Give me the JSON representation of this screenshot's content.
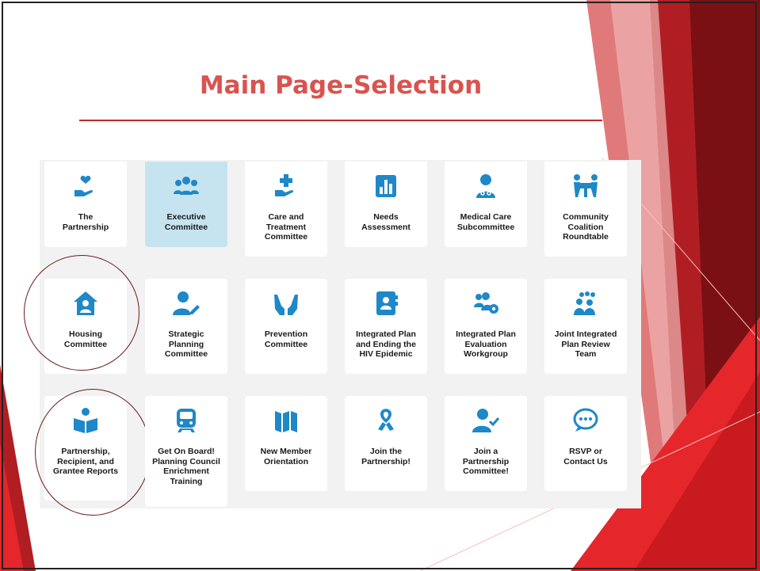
{
  "slide": {
    "title": "Main Page-Selection",
    "accent_color": "#c0282d",
    "title_color": "#d9534f"
  },
  "menu": {
    "icon_color": "#1e88c8",
    "items": [
      {
        "label": "The\nPartnership",
        "icon": "heart-hand-icon",
        "active": false,
        "circled": false
      },
      {
        "label": "Executive\nCommittee",
        "icon": "group-icon",
        "active": true,
        "circled": false
      },
      {
        "label": "Care and\nTreatment\nCommittee",
        "icon": "plus-hand-icon",
        "active": false,
        "circled": false
      },
      {
        "label": "Needs\nAssessment",
        "icon": "bar-chart-icon",
        "active": false,
        "circled": false
      },
      {
        "label": "Medical Care\nSubcommittee",
        "icon": "doctor-icon",
        "active": false,
        "circled": false
      },
      {
        "label": "Community\nCoalition\nRoundtable",
        "icon": "people-table-icon",
        "active": false,
        "circled": false
      },
      {
        "label": "Housing\nCommittee",
        "icon": "house-user-icon",
        "active": false,
        "circled": true
      },
      {
        "label": "Strategic\nPlanning\nCommittee",
        "icon": "user-pen-icon",
        "active": false,
        "circled": false
      },
      {
        "label": "Prevention\nCommittee",
        "icon": "hands-icon",
        "active": false,
        "circled": false
      },
      {
        "label": "Integrated Plan\nand Ending the\nHIV Epidemic",
        "icon": "address-book-icon",
        "active": false,
        "circled": false
      },
      {
        "label": "Integrated Plan\nEvaluation\nWorkgroup",
        "icon": "users-gear-icon",
        "active": false,
        "circled": false
      },
      {
        "label": "Joint Integrated\nPlan Review\nTeam",
        "icon": "team-icon",
        "active": false,
        "circled": false
      },
      {
        "label": "Partnership,\nRecipient, and\nGrantee Reports",
        "icon": "reader-icon",
        "active": false,
        "circled": true
      },
      {
        "label": "Get On Board!\nPlanning Council\nEnrichment\nTraining",
        "icon": "train-icon",
        "active": false,
        "circled": false
      },
      {
        "label": "New Member\nOrientation",
        "icon": "map-icon",
        "active": false,
        "circled": false
      },
      {
        "label": "Join the\nPartnership!",
        "icon": "ribbon-icon",
        "active": false,
        "circled": false
      },
      {
        "label": "Join a\nPartnership\nCommittee!",
        "icon": "user-check-icon",
        "active": false,
        "circled": false
      },
      {
        "label": "RSVP or\nContact Us",
        "icon": "chat-icon",
        "active": false,
        "circled": false
      }
    ]
  }
}
